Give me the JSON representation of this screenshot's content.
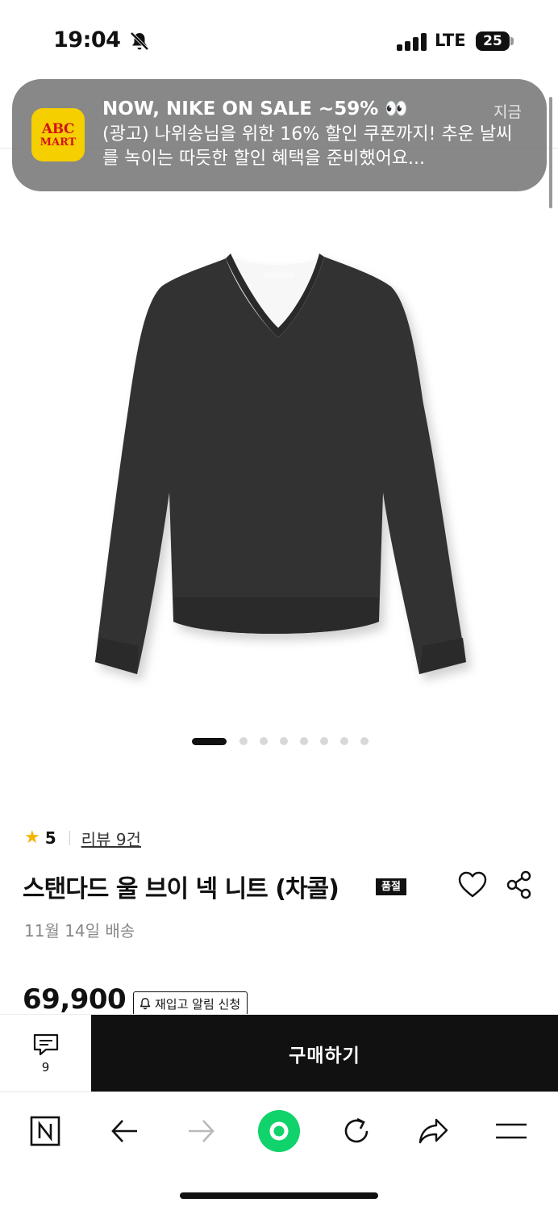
{
  "status_bar": {
    "time": "19:04",
    "network": "LTE",
    "battery": "25"
  },
  "notification": {
    "app_icon_line1": "ABC",
    "app_icon_line2": "MART",
    "title": "NOW, NIKE ON SALE ~59% 👀",
    "time": "지금",
    "body": "(광고) 나위송님을 위한 16% 할인 쿠폰까지! 추운 날씨를 녹이는 따듯한 할인 혜택을 준비했어요..."
  },
  "gallery": {
    "image_icon": "v-neck-sweater-image",
    "total": 8,
    "active_index": 0
  },
  "product": {
    "rating_icon": "star-icon",
    "rating": "5",
    "review_link": "리뷰 9건",
    "title": "스탠다드 울 브이 넥 니트 (차콜)",
    "soldout_badge": "품절",
    "delivery": "11월 14일 배송",
    "price": "69,900",
    "restock_button": "재입고 알림 신청"
  },
  "buy_bar": {
    "comment_count": "9",
    "buy_label": "구매하기"
  },
  "toolbar": {
    "items": [
      "naver-n-icon",
      "back-arrow-icon",
      "forward-arrow-icon",
      "green-dot-icon",
      "reload-icon",
      "share-arrow-icon",
      "menu-icon"
    ]
  },
  "colors": {
    "accent_green": "#10d36b",
    "star": "#f6b300",
    "abc_mart_yellow": "#f5cf00",
    "abc_mart_red": "#d2141c"
  }
}
